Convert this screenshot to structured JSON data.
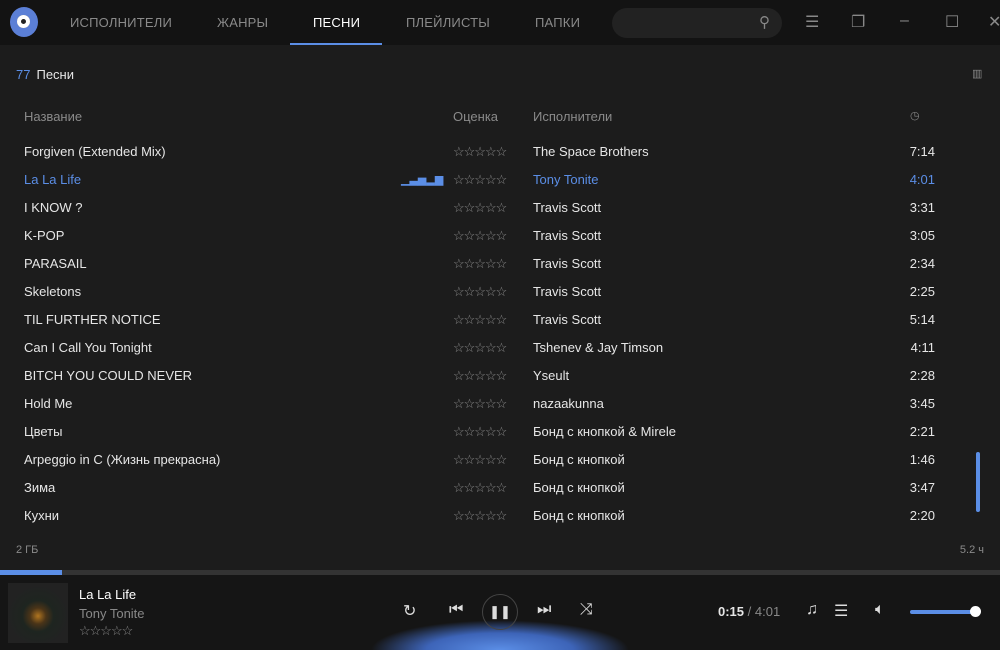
{
  "tabs": [
    "ИСПОЛНИТЕЛИ",
    "ЖАНРЫ",
    "ПЕСНИ",
    "ПЛЕЙЛИСТЫ",
    "ПАПКИ"
  ],
  "count": "77",
  "section": "Песни",
  "columns": {
    "title": "Название",
    "rating": "Оценка",
    "artist": "Исполнители"
  },
  "rows": [
    {
      "t": "Forgiven (Extended Mix)",
      "a": "The Space Brothers",
      "d": "7:14"
    },
    {
      "t": "La La Life",
      "a": "Tony Tonite",
      "d": "4:01"
    },
    {
      "t": "I KNOW ?",
      "a": "Travis Scott",
      "d": "3:31"
    },
    {
      "t": "K-POP",
      "a": "Travis Scott",
      "d": "3:05"
    },
    {
      "t": "PARASAIL",
      "a": "Travis Scott",
      "d": "2:34"
    },
    {
      "t": "Skeletons",
      "a": "Travis Scott",
      "d": "2:25"
    },
    {
      "t": "TIL FURTHER NOTICE",
      "a": "Travis Scott",
      "d": "5:14"
    },
    {
      "t": "Can I Call You Tonight",
      "a": "Tshenev & Jay Timson",
      "d": "4:11"
    },
    {
      "t": "BITCH YOU COULD NEVER",
      "a": "Yseult",
      "d": "2:28"
    },
    {
      "t": "Hold Me",
      "a": "nazaakunna",
      "d": "3:45"
    },
    {
      "t": "Цветы",
      "a": "Бонд с кнопкой & Mirele",
      "d": "2:21"
    },
    {
      "t": "Arpeggio in C (Жизнь прекрасна)",
      "a": "Бонд с кнопкой",
      "d": "1:46"
    },
    {
      "t": "Зима",
      "a": "Бонд с кнопкой",
      "d": "3:47"
    },
    {
      "t": "Кухни",
      "a": "Бонд с кнопкой",
      "d": "2:20"
    }
  ],
  "footer": {
    "size": "2 ГБ",
    "duration": "5.2 ч"
  },
  "player": {
    "title": "La La Life",
    "artist": "Tony Tonite",
    "elapsed": "0:15",
    "total": "/ 4:01",
    "progress": 0.062,
    "volume": 1.0
  },
  "accent": "#5b8ee6"
}
